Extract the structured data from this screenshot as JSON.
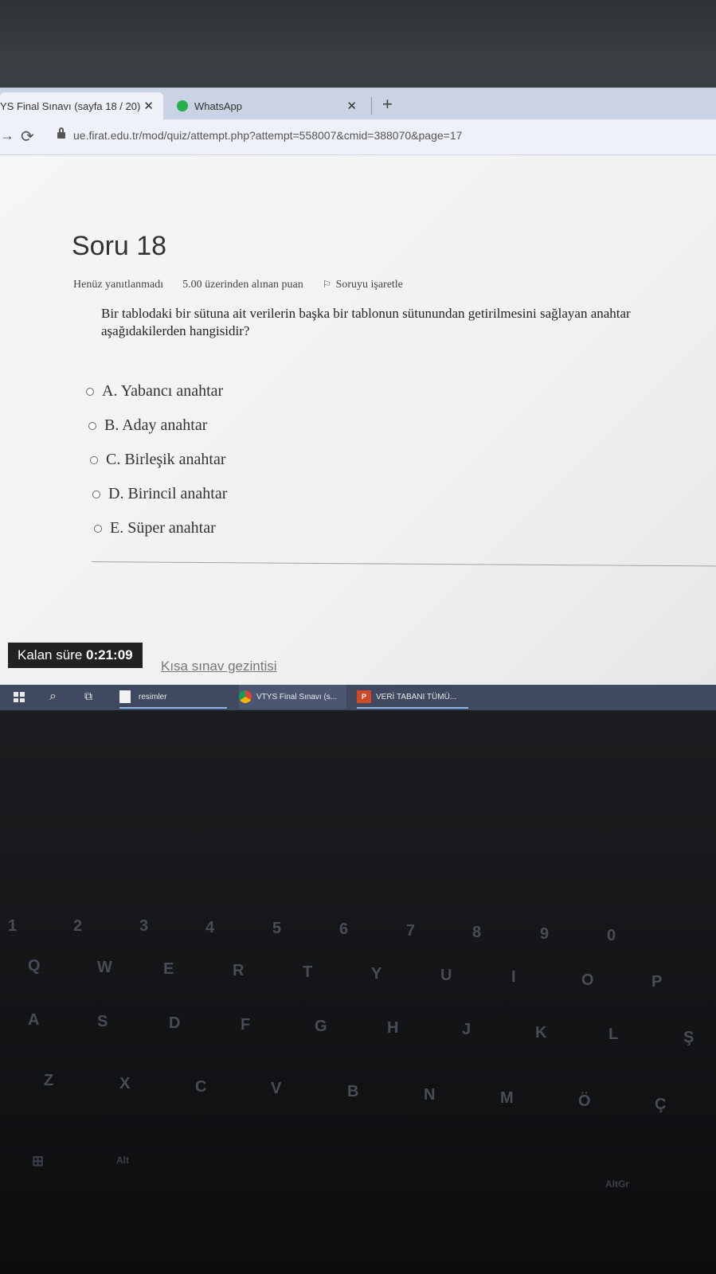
{
  "browser": {
    "tabs": [
      {
        "label": "YS Final Sınavı (sayfa 18 / 20)",
        "close": "✕",
        "active": true
      },
      {
        "label": "WhatsApp",
        "close": "✕",
        "active": false
      }
    ],
    "new_tab": "+",
    "url": "ue.firat.edu.tr/mod/quiz/attempt.php?attempt=558007&cmid=388070&page=17"
  },
  "question": {
    "title": "Soru 18",
    "status": "Henüz yanıtlanmadı",
    "points": "5.00 üzerinden alınan puan",
    "flag_label": "Soruyu işaretle",
    "text": "Bir tablodaki bir sütuna ait verilerin başka bir tablonun sütunundan getirilmesini sağlayan anahtar aşağıdakilerden hangisidir?",
    "options": [
      "A. Yabancı anahtar",
      "B. Aday anahtar",
      "C. Birleşik anahtar",
      "D. Birincil anahtar",
      "E. Süper anahtar"
    ]
  },
  "quiz_footer": {
    "timer_label": "Kalan süre",
    "timer_value": "0:21:09",
    "quick_nav": "Kısa sınav gezintisi"
  },
  "taskbar": {
    "items": [
      "resimler",
      "VTYS Final Sınavı (s...",
      "VERİ TABANI TÜMÜ..."
    ]
  },
  "keyboard": {
    "number_row": [
      "1",
      "2",
      "3",
      "4",
      "5",
      "6",
      "7",
      "8",
      "9",
      "0"
    ],
    "row_q": [
      "Q",
      "W",
      "E",
      "R",
      "T",
      "Y",
      "U",
      "I",
      "O",
      "P"
    ],
    "row_a": [
      "A",
      "S",
      "D",
      "F",
      "G",
      "H",
      "J",
      "K",
      "L",
      "Ş"
    ],
    "row_z": [
      "Z",
      "X",
      "C",
      "V",
      "B",
      "N",
      "M",
      "Ö",
      "Ç"
    ],
    "alt": "Alt",
    "altgr": "AltGr"
  }
}
